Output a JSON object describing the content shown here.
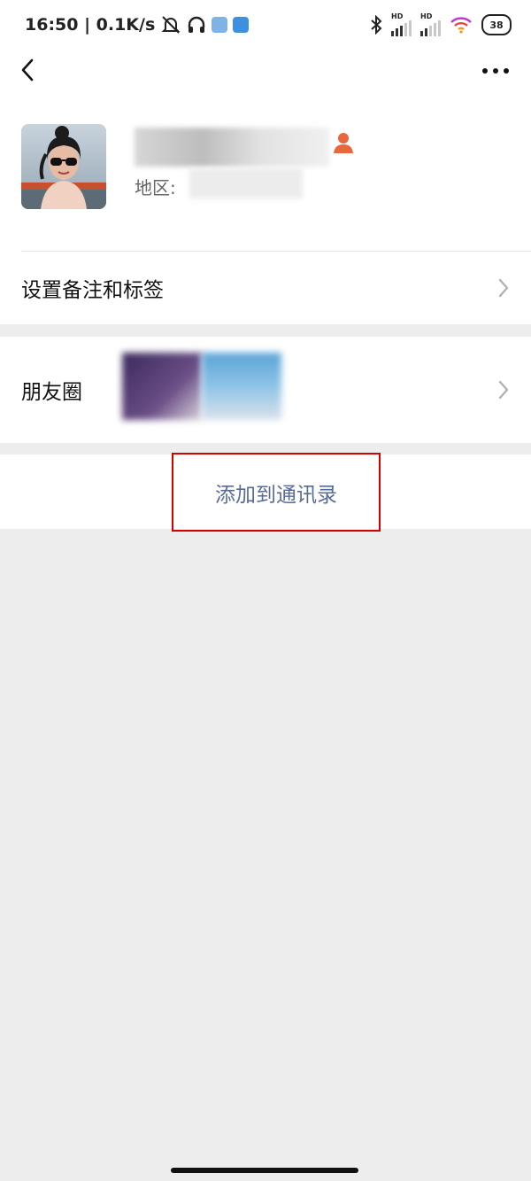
{
  "status_bar": {
    "time_speed": "16:50 | 0.1K/s",
    "hd1": "HD",
    "hd2": "HD",
    "battery": "38"
  },
  "nav": {
    "back_icon": "chevron-left-icon",
    "more_icon": "more-dots-icon"
  },
  "profile": {
    "region_label": "地区:",
    "contact_icon": "contact-person-icon"
  },
  "rows": {
    "remarks_label": "设置备注和标签",
    "moments_label": "朋友圈"
  },
  "add_contact": {
    "label": "添加到通讯录",
    "highlight_color": "#d40000",
    "text_color": "#576b95"
  }
}
